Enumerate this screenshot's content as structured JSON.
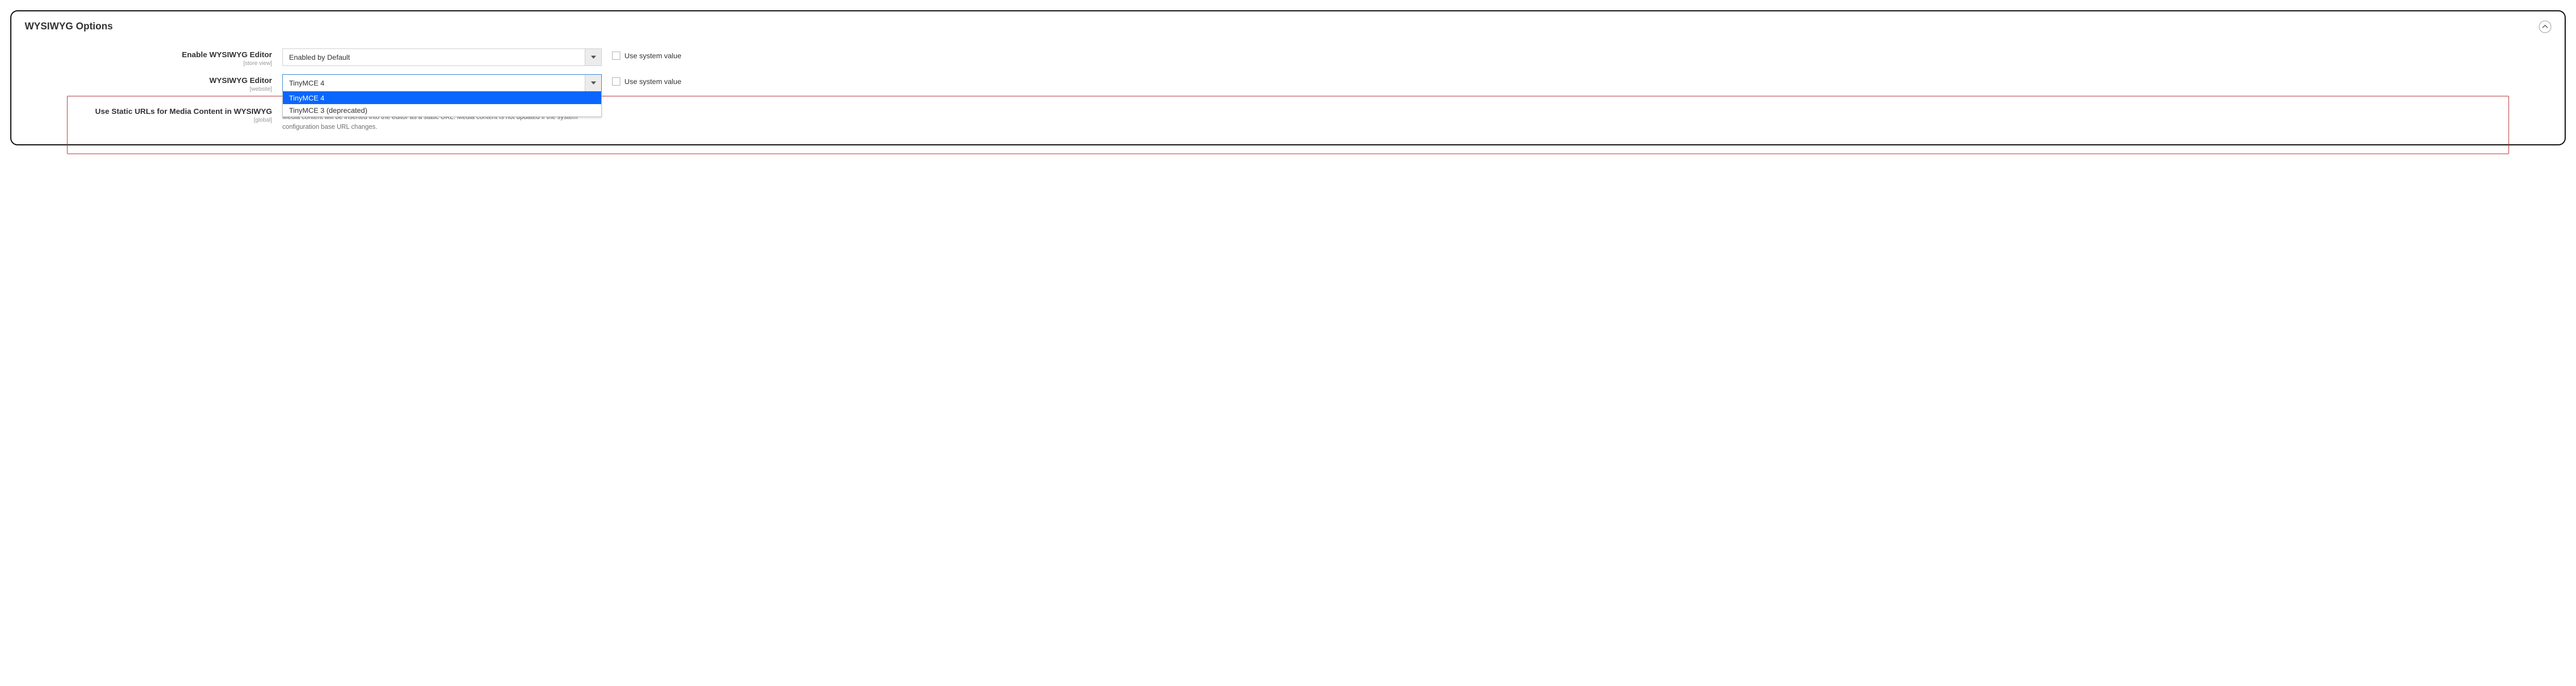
{
  "panel": {
    "title": "WYSIWYG Options"
  },
  "fields": {
    "enable": {
      "label": "Enable WYSIWYG Editor",
      "scope": "[store view]",
      "value": "Enabled by Default",
      "use_system": "Use system value"
    },
    "editor": {
      "label": "WYSIWYG Editor",
      "scope": "[website]",
      "value": "TinyMCE 4",
      "use_system": "Use system value",
      "options": {
        "0": "TinyMCE 4",
        "1": "TinyMCE 3 (deprecated)"
      }
    },
    "static_urls": {
      "label": "Use Static URLs for Media Content in WYSIWYG",
      "scope": "[global]",
      "value_partial": "",
      "help": "Media content will be inserted into the editor as a static URL. Media content is not updated if the system configuration base URL changes."
    }
  }
}
